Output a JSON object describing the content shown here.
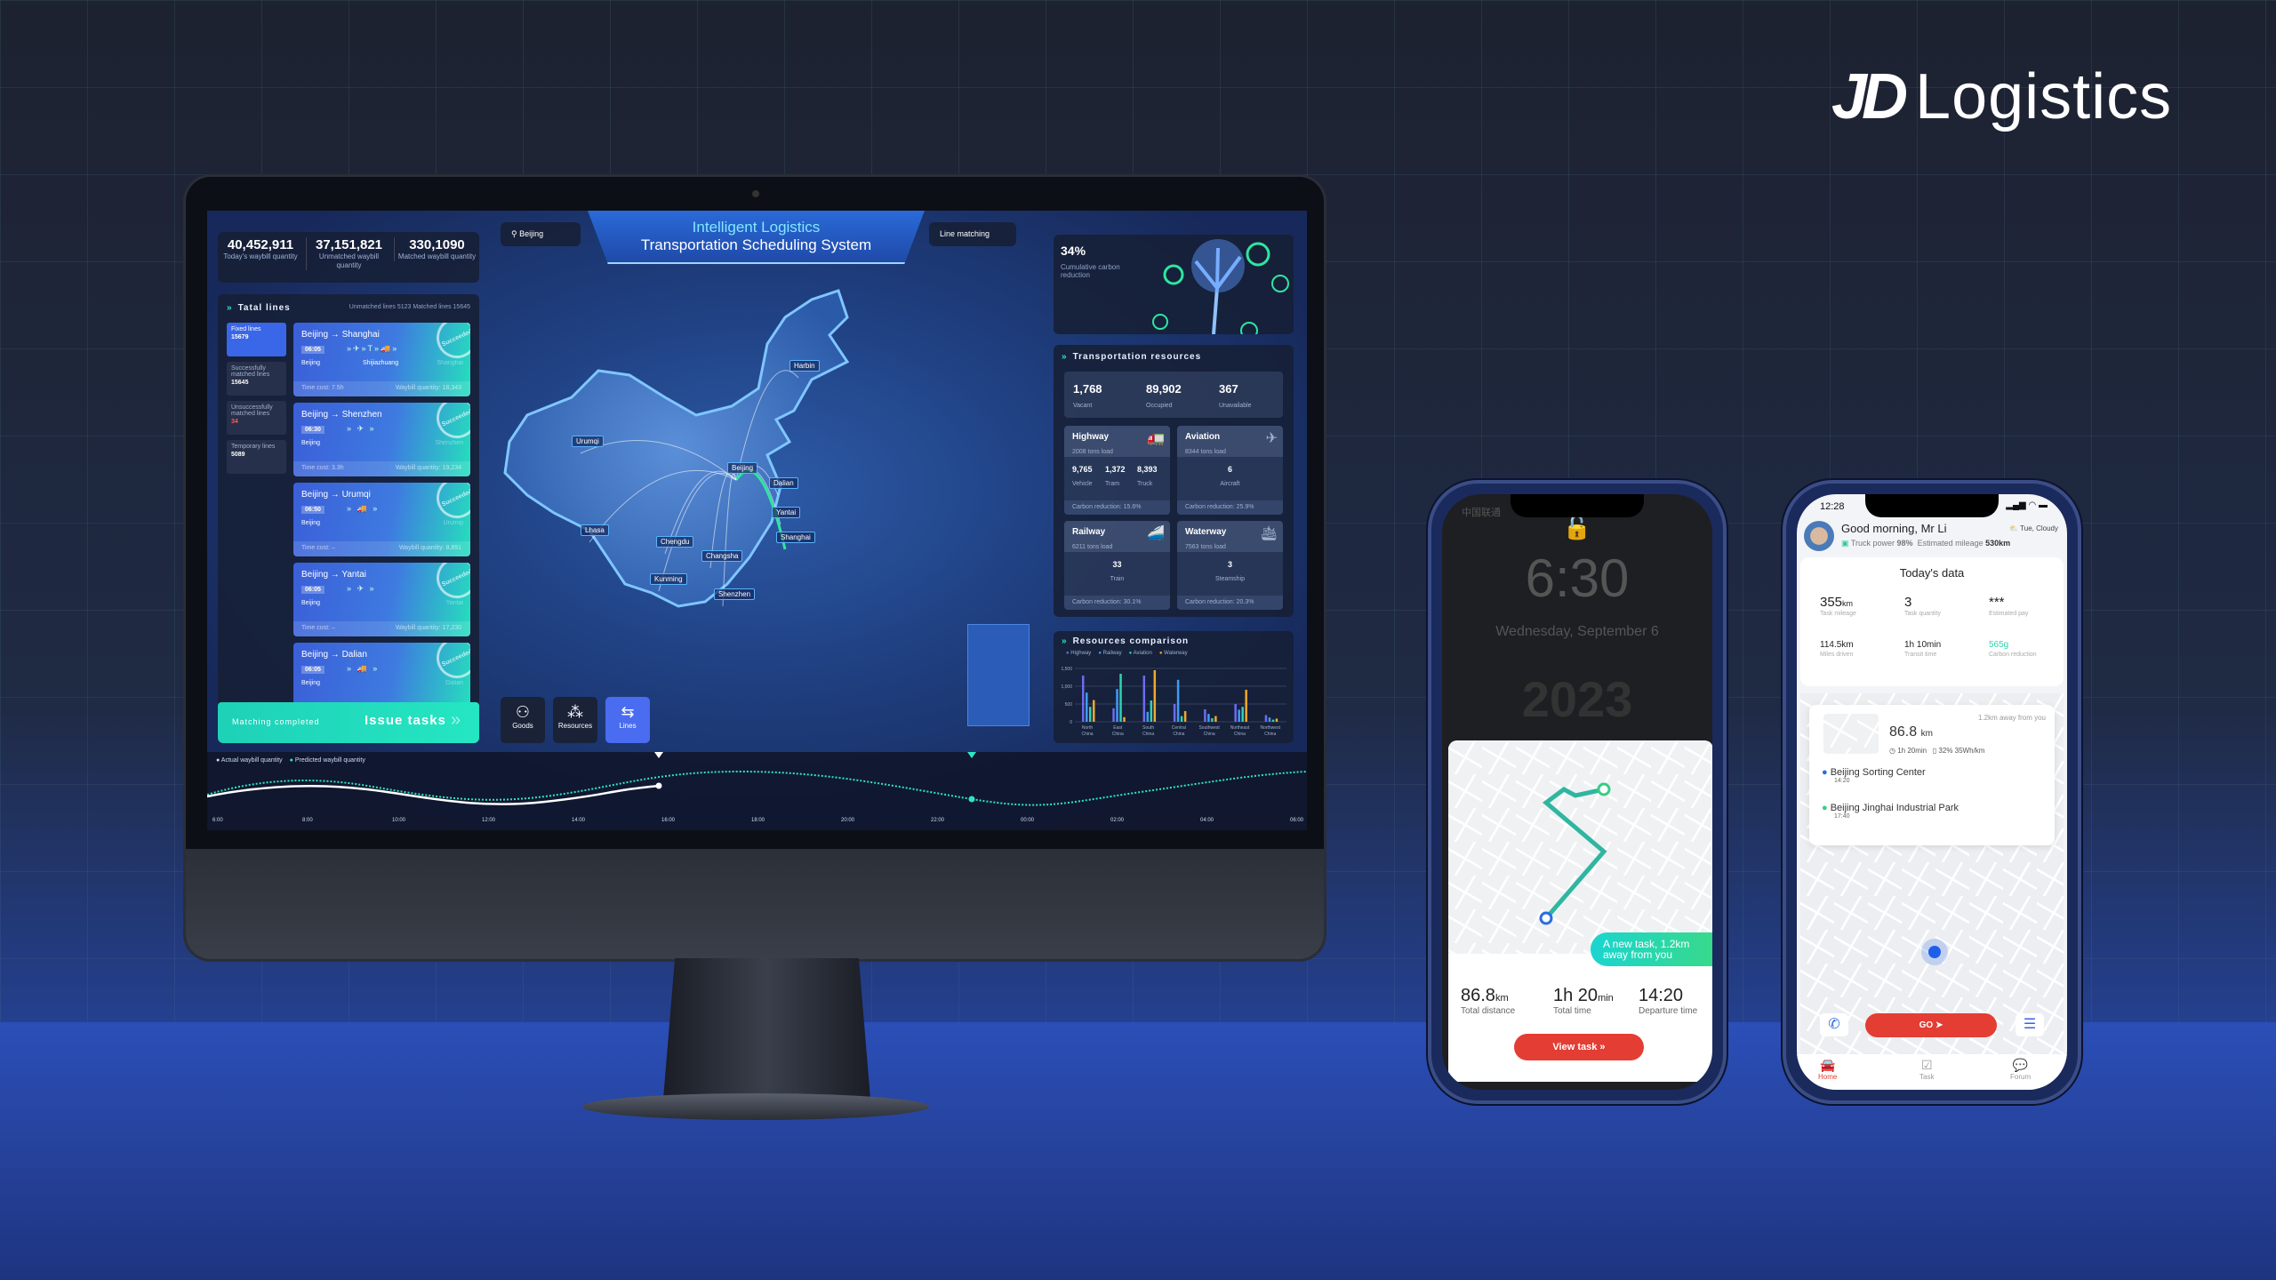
{
  "brand": {
    "logo_text": "JD",
    "logo_word": "Logistics"
  },
  "dashboard": {
    "title_line1": "Intelligent Logistics",
    "title_line2": "Transportation Scheduling System",
    "location": "Beijing",
    "line_matching": "Line matching",
    "stats": [
      {
        "value": "40,452,911",
        "label": "Today's waybill quantity"
      },
      {
        "value": "37,151,821",
        "label": "Unmatched waybill quantity"
      },
      {
        "value": "330,1090",
        "label": "Matched waybill quantity"
      }
    ],
    "lines_panel": {
      "title": "Tatal lines",
      "summary": "Unmatched lines 5123  Matched lines 15645",
      "tabs": [
        {
          "label": "Fixed lines",
          "value": "15679"
        },
        {
          "label": "Successfully matched lines",
          "value": "15645"
        },
        {
          "label": "Unsuccessfully matched lines",
          "value": "34"
        },
        {
          "label": "Temporary lines",
          "value": "5089"
        }
      ],
      "cards": [
        {
          "route": "Beijing → Shanghai",
          "time": "06:05",
          "from": "Beijing",
          "via": "Shijiazhuang",
          "to": "Shanghai",
          "vehicles": "»✈»T»🚚»",
          "cost": "Time cost: 7.5h",
          "waybill": "Waybill quantity: 18,343",
          "stamp": "Succeeded"
        },
        {
          "route": "Beijing → Shenzhen",
          "time": "06:30",
          "from": "Beijing",
          "via": "",
          "to": "Shenzhen",
          "vehicles": "» ✈ »",
          "cost": "Time cost: 3.3h",
          "waybill": "Waybill quantity: 19,234",
          "stamp": "Succeeded"
        },
        {
          "route": "Beijing → Urumqi",
          "time": "06:50",
          "from": "Beijing",
          "via": "",
          "to": "Urumqi",
          "vehicles": "» 🚚 »",
          "cost": "Time cost: –",
          "waybill": "Waybill quantity: 8,891",
          "stamp": "Succeeded"
        },
        {
          "route": "Beijing → Yantai",
          "time": "06:05",
          "from": "Beijing",
          "via": "",
          "to": "Yantai",
          "vehicles": "» ✈ »",
          "cost": "Time cost: –",
          "waybill": "Waybill quantity: 17,230",
          "stamp": "Succeeded"
        },
        {
          "route": "Beijing → Dalian",
          "time": "06:05",
          "from": "Beijing",
          "via": "",
          "to": "Dalian",
          "vehicles": "» 🚚 »",
          "cost": "",
          "waybill": "",
          "stamp": "Succeeded"
        }
      ],
      "matching_status": "Matching completed",
      "issue_button": "Issue tasks"
    },
    "map_buttons": [
      {
        "label": "Goods",
        "icon": "goods-icon"
      },
      {
        "label": "Resources",
        "icon": "resources-icon"
      },
      {
        "label": "Lines",
        "icon": "lines-icon",
        "active": true
      }
    ],
    "cities": [
      "Urumqi",
      "Harbin",
      "Beijing",
      "Dalian",
      "Yantai",
      "Lhasa",
      "Chengdu",
      "Shanghai",
      "Changsha",
      "Kunming",
      "Shenzhen"
    ],
    "carbon": {
      "value": "34%",
      "label": "Cumulative carbon reduction"
    },
    "resources": {
      "title": "Transportation resources",
      "summary": [
        {
          "value": "1,768",
          "label": "Vacant"
        },
        {
          "value": "89,902",
          "label": "Occupied"
        },
        {
          "value": "367",
          "label": "Unavailable"
        }
      ],
      "modes": [
        {
          "name": "Highway",
          "load": "2008 tons load",
          "items": [
            {
              "value": "9,765",
              "label": "Vehicle"
            },
            {
              "value": "1,372",
              "label": "Tram"
            },
            {
              "value": "8,393",
              "label": "Truck"
            }
          ],
          "carbon": "Carbon reduction: 15.6%"
        },
        {
          "name": "Aviation",
          "load": "8344 tons load",
          "items": [
            {
              "value": "6",
              "label": "Aircraft"
            }
          ],
          "carbon": "Carbon reduction: 25.9%"
        },
        {
          "name": "Railway",
          "load": "6211 tons load",
          "items": [
            {
              "value": "33",
              "label": "Train"
            }
          ],
          "carbon": "Carbon reduction: 30.1%"
        },
        {
          "name": "Waterway",
          "load": "7563 tons load",
          "items": [
            {
              "value": "3",
              "label": "Steamship"
            }
          ],
          "carbon": "Carbon reduction: 20.3%"
        }
      ]
    },
    "comparison": {
      "title": "Resources comparison",
      "series": [
        {
          "name": "Highway",
          "color": "#6b6cf0",
          "values": [
            1300,
            380,
            1300,
            500,
            350,
            500,
            190
          ]
        },
        {
          "name": "Railway",
          "color": "#3f9cf5",
          "values": [
            820,
            920,
            280,
            1180,
            220,
            340,
            120
          ]
        },
        {
          "name": "Aviation",
          "color": "#2ed3b0",
          "values": [
            420,
            1350,
            600,
            160,
            100,
            420,
            60
          ]
        },
        {
          "name": "Waterway",
          "color": "#f0a928",
          "values": [
            610,
            130,
            1450,
            300,
            160,
            900,
            90
          ]
        }
      ],
      "categories": [
        "North China",
        "East China",
        "South China",
        "Central China",
        "Southwest China",
        "Northeast China",
        "Northwest China"
      ],
      "yticks": [
        "0",
        "500",
        "1,000",
        "1,500"
      ],
      "ymax": 1500
    },
    "timeline": {
      "legend": [
        "Actual waybill quantity",
        "Predicted waybill quantity"
      ],
      "ticks": [
        "6:00",
        "8:00",
        "10:00",
        "12:00",
        "14:00",
        "16:00",
        "18:00",
        "20:00",
        "22:00",
        "00:00",
        "02:00",
        "04:00",
        "06:00"
      ]
    }
  },
  "phone1": {
    "carrier": "中国联通",
    "time": "6:30",
    "date": "Wednesday, September 6",
    "year_art": "2023",
    "toast": "A new task, 1.2km away from you",
    "stats": [
      {
        "value": "86.8",
        "unit": "km",
        "label": "Total distance"
      },
      {
        "value": "1h 20",
        "unit": "min",
        "label": "Total time"
      },
      {
        "value": "14:20",
        "unit": "",
        "label": "Departure time"
      }
    ],
    "button": "View task"
  },
  "phone2": {
    "time": "12:28",
    "greeting": "Good morning, Mr Li",
    "weather": "Tue, Cloudy",
    "truck_power_label": "Truck power",
    "truck_power": "98%",
    "mileage_label": "Estimated mileage",
    "mileage": "530km",
    "today_title": "Today's data",
    "today": [
      {
        "value": "355",
        "unit": "km",
        "label": "Task mileage"
      },
      {
        "value": "3",
        "unit": "",
        "label": "Task quantity"
      },
      {
        "value": "***",
        "unit": "",
        "label": "Estimated pay"
      },
      {
        "value": "114.5km",
        "unit": "",
        "label": "Miles driven"
      },
      {
        "value": "1h 10min",
        "unit": "",
        "label": "Transit time"
      },
      {
        "value": "565g",
        "unit": "",
        "label": "Carbon reduction"
      }
    ],
    "task": {
      "distance_away": "1.2km away from you",
      "distance": "86.8",
      "unit": "km",
      "duration": "1h 20min",
      "energy": "32% 35Wh/km",
      "stops": [
        {
          "name": "Beijing Sorting Center",
          "time": "14:20"
        },
        {
          "name": "Beijing Jinghai Industrial Park",
          "time": "17:40"
        }
      ]
    },
    "go": "GO",
    "tabs": [
      "Home",
      "Task",
      "Forum"
    ]
  }
}
